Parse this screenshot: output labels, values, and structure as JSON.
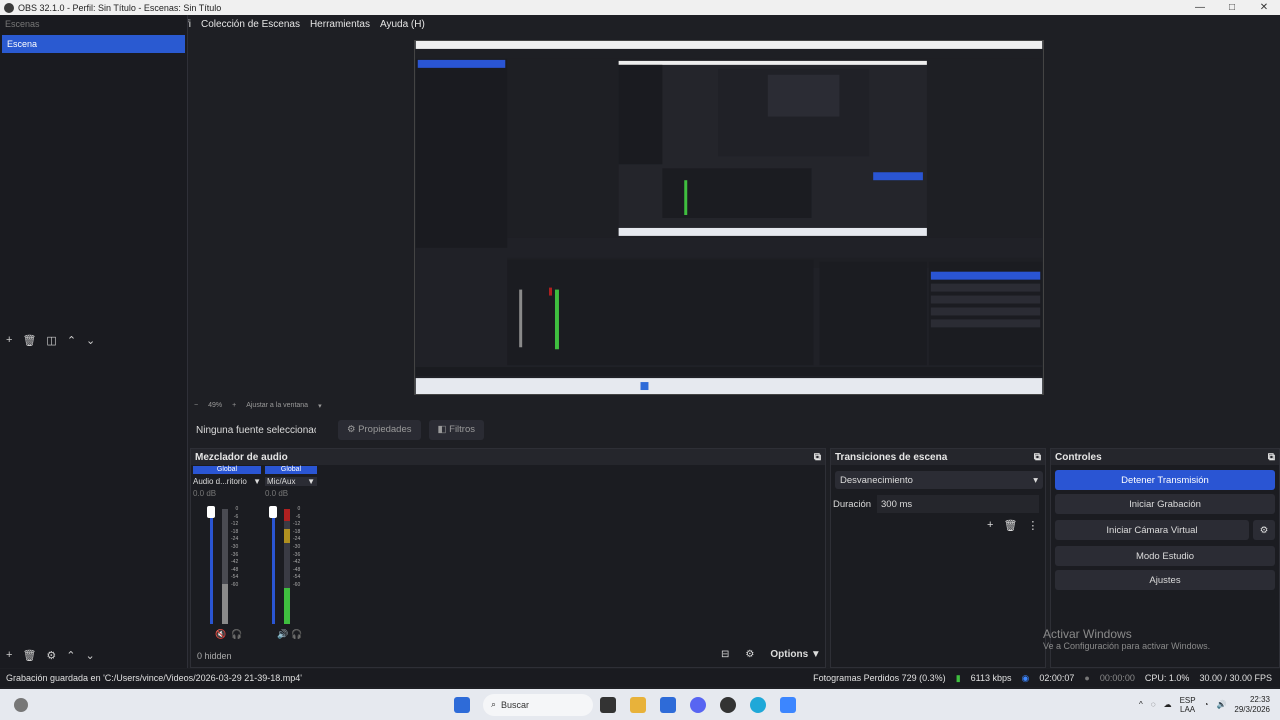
{
  "window": {
    "title": "OBS 32.1.0 - Perfil: Sin Título - Escenas: Sin Título",
    "controls": [
      "—",
      "□",
      "✕"
    ]
  },
  "menu": {
    "items": [
      "fi",
      "Colección de Escenas",
      "Herramientas",
      "Ayuda (H)"
    ]
  },
  "scenes": {
    "header": "Escenas",
    "items": [
      "Escena"
    ]
  },
  "zoom": {
    "minus": "−",
    "value": "49%",
    "plus": "+",
    "fit": "Ajustar a la ventana"
  },
  "sources_bar": {
    "none": "Ninguna fuente seleccionac",
    "properties": "Propiedades",
    "filters": "Filtros"
  },
  "mixer": {
    "title": "Mezclador de audio",
    "channels": [
      {
        "tag": "Global",
        "name": "Audio d...ritorio",
        "db": "0.0 dB",
        "ticks": [
          "0",
          "-6",
          "-12",
          "-18",
          "-24",
          "-30",
          "-36",
          "-42",
          "-48",
          "-54",
          "-60"
        ]
      },
      {
        "tag": "Global",
        "name": "Mic/Aux",
        "db": "0.0 dB",
        "ticks": [
          "0",
          "-6",
          "-12",
          "-18",
          "-24",
          "-30",
          "-36",
          "-42",
          "-48",
          "-54",
          "-60"
        ]
      }
    ],
    "hidden": "0 hidden",
    "options": "Options"
  },
  "transitions": {
    "title": "Transiciones de escena",
    "selected": "Desvanecimiento",
    "duration_label": "Duración",
    "duration_value": "300 ms"
  },
  "controls": {
    "title": "Controles",
    "buttons": [
      "Detener Transmisión",
      "Iniciar Grabación",
      "Iniciar Cámara Virtual",
      "Modo Estudio",
      "Ajustes"
    ]
  },
  "watermark": {
    "line1": "Activar Windows",
    "line2": "Ve a Configuración para activar Windows."
  },
  "status": {
    "message": "Grabación guardada en 'C:/Users/vince/Videos/2026-03-29 21-39-18.mp4'",
    "dropped": "Fotogramas Perdidos 729 (0.3%)",
    "kbps": "6113 kbps",
    "stream_time": "02:00:07",
    "rec_time": "00:00:00",
    "cpu": "CPU: 1.0%",
    "fps": "30.00 / 30.00 FPS"
  },
  "taskbar": {
    "search": "Buscar",
    "lang1": "ESP",
    "lang2": "LAA",
    "time": "22:33",
    "date": "29/3/2026"
  },
  "colors": {
    "accent": "#2a55d3",
    "bg": "#1e1f24",
    "meter_green": "#3fbf3f",
    "meter_red": "#b02020"
  }
}
